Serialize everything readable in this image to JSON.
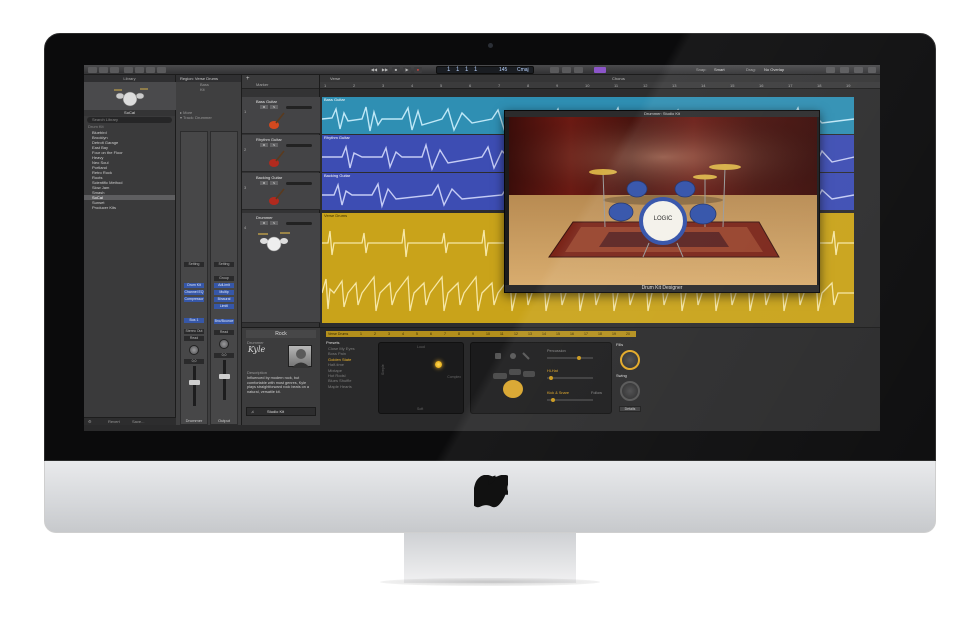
{
  "colors": {
    "cyan_region": "#2f8fb3",
    "blue_region": "#3d4db3",
    "gold_region": "#c9a31a",
    "accent_gold": "#e3a824"
  },
  "toolbar": {
    "lcd_position": "1  1  1  1",
    "lcd_tempo": "145",
    "lcd_key": "Cmaj",
    "snap_label": "Snap:",
    "snap_value": "Smart",
    "drag_label": "Drag:",
    "drag_value": "No Overlap"
  },
  "library": {
    "title": "Library",
    "selected_name": "SoCal",
    "search_placeholder": "Search Library",
    "category": "Drum Kit",
    "items": [
      "Bluebird",
      "Brooklyn",
      "Detroit Garage",
      "East Bay",
      "Four on the Floor",
      "Heavy",
      "Neo Soul",
      "Portland",
      "Retro Rock",
      "Roots",
      "Scientific Method",
      "Slow Jam",
      "Smash",
      "SoCal",
      "Sunset",
      "Producer Kits"
    ],
    "selected_index": 13,
    "footer_revert": "Revert",
    "footer_save": "Save..."
  },
  "inspector": {
    "region_label": "Region: Verse Drums",
    "sub1": "Bass",
    "sub2": "Kit",
    "more_label": "▸ More",
    "track_label": "▾ Track: Drummer",
    "strip1": {
      "setting": "Setting",
      "plugin": "Drum Kit",
      "plugin2": "Channel EQ",
      "plugin3": "Compressor",
      "bus": "Bus 1",
      "stereo": "Stereo Out",
      "read": "Read",
      "name": "Drummer",
      "vol": "0,0"
    },
    "strip2": {
      "setting": "Setting",
      "group": "Group",
      "plugin1": "AdLimit",
      "plugin2": "Multip",
      "plugin3": "Binaural",
      "plugin4": "LimitI",
      "bus": "Bnc/Bounce",
      "read": "Read",
      "name": "Output",
      "vol": "0,0"
    }
  },
  "tracks": [
    {
      "num": "1",
      "name": "Bass Guitar",
      "color": "#2f8fb3"
    },
    {
      "num": "2",
      "name": "Rhythm Guitar",
      "color": "#3d4db3"
    },
    {
      "num": "3",
      "name": "Backing Guitar",
      "color": "#3d4db3"
    },
    {
      "num": "4",
      "name": "Drummer",
      "color": "#c9a31a"
    }
  ],
  "arrange": {
    "marker_label": "Marker",
    "marker_verse": "Verse",
    "marker_chorus": "Chorus",
    "ruler": [
      "1",
      "2",
      "3",
      "4",
      "5",
      "6",
      "7",
      "8",
      "9",
      "10",
      "11",
      "12",
      "13",
      "14",
      "15",
      "16",
      "17",
      "18",
      "19"
    ],
    "regions": [
      {
        "label": "Bass Guitar"
      },
      {
        "label": "Rhythm Guitar"
      },
      {
        "label": "Backing Guitar"
      },
      {
        "label": "Verse Drums"
      }
    ]
  },
  "plugin": {
    "title": "Drummer: Studio Kit",
    "footer": "Drum Kit Designer",
    "kick_logo": "LOGIC"
  },
  "editor": {
    "genre": "Rock",
    "drummer_label": "Drummer",
    "drummer_name": "Kyle",
    "description_label": "Description",
    "description": "Influenced by modern rock, but comfortable with most genres, Kyle plays straightforward rock beats on a natural, versatile kit.",
    "kit_name": "Studio Kit",
    "region_label": "Verse Drums",
    "ruler": [
      "1",
      "2",
      "3",
      "4",
      "5",
      "6",
      "7",
      "8",
      "9",
      "10",
      "11",
      "12",
      "13",
      "14",
      "15",
      "16",
      "17",
      "18",
      "19",
      "20"
    ],
    "presets_label": "Presets",
    "presets": [
      "Close My Eyes",
      "Boss Pain",
      "Golden State",
      "Half-time",
      "Mixtape",
      "Hot Rodsl",
      "Blues Shuffle",
      "Maple Hearts"
    ],
    "selected_preset_index": 2,
    "xy_top": "Loud",
    "xy_bottom": "Soft",
    "xy_left": "Simple",
    "xy_right": "Complex",
    "percussion_label": "Percussion",
    "hihat_label": "Hi-Hat",
    "kick_snare_label": "Kick & Snare",
    "follow_label": "Follow",
    "fills_label": "Fills",
    "swing_label": "Swing",
    "details_label": "Details"
  }
}
